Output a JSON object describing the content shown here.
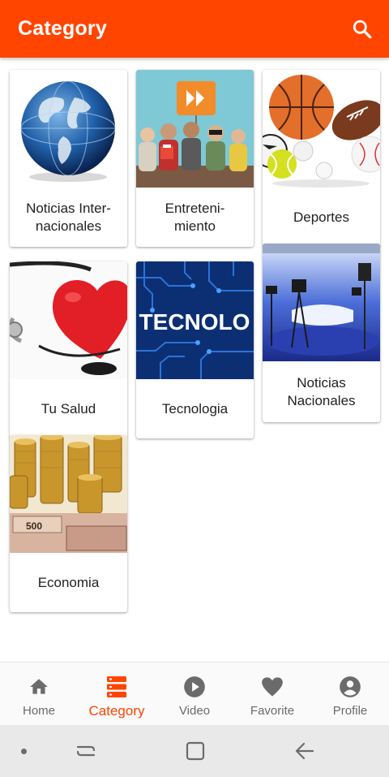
{
  "appbar": {
    "title": "Category",
    "search_icon": "search-icon"
  },
  "categories": [
    {
      "label": "Noticias Inter-\nnacionales",
      "image": "globe"
    },
    {
      "label": "Entreteni-\nmiento",
      "image": "audience"
    },
    {
      "label": "Deportes",
      "image": "sports-balls"
    },
    {
      "label": "Tu Salud",
      "image": "heart-stethoscope"
    },
    {
      "label": "Tecnologia",
      "image": "circuit-board",
      "image_text": "TECNOLO"
    },
    {
      "label": "Noticias\nNacionales",
      "image": "tv-studio"
    },
    {
      "label": "Economia",
      "image": "coins-banknotes",
      "image_text": "500"
    }
  ],
  "bottom_nav": {
    "items": [
      {
        "label": "Home",
        "icon": "home-icon",
        "active": false
      },
      {
        "label": "Category",
        "icon": "category-icon",
        "active": true
      },
      {
        "label": "Video",
        "icon": "play-circle-icon",
        "active": false
      },
      {
        "label": "Favorite",
        "icon": "heart-icon",
        "active": false
      },
      {
        "label": "Profile",
        "icon": "account-circle-icon",
        "active": false
      }
    ]
  },
  "colors": {
    "accent": "#ff4500",
    "inactive": "#6b6b6b",
    "background": "#ffffff"
  }
}
